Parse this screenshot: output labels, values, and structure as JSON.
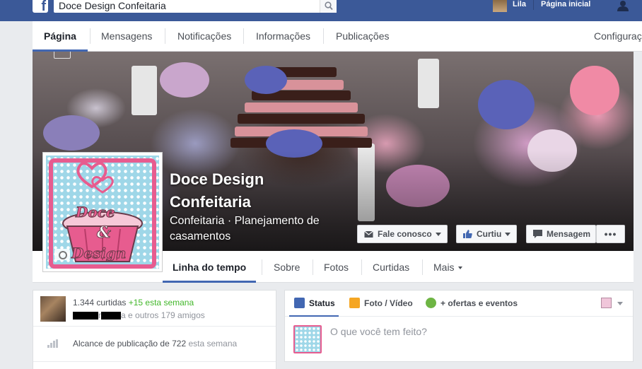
{
  "topbar": {
    "search_value": "Doce Design Confeitaria",
    "user_name": "Lila",
    "home_label": "Página inicial"
  },
  "page_nav": {
    "tabs": [
      {
        "label": "Página",
        "active": true
      },
      {
        "label": "Mensagens",
        "active": false
      },
      {
        "label": "Notificações",
        "active": false
      },
      {
        "label": "Informações",
        "active": false
      },
      {
        "label": "Publicações",
        "active": false
      }
    ],
    "settings_label": "Configuraç"
  },
  "page": {
    "title": "Doce Design Confeitaria",
    "category": "Confeitaria · Planejamento de casamentos",
    "logo_text_1": "Doce",
    "logo_text_2": "&",
    "logo_text_3": "Design"
  },
  "cover_actions": {
    "contact_label": "Fale conosco",
    "liked_label": "Curtiu",
    "message_label": "Mensagem",
    "more_label": "•••"
  },
  "timeline_nav": {
    "items": [
      {
        "label": "Linha do tempo",
        "active": true
      },
      {
        "label": "Sobre",
        "active": false
      },
      {
        "label": "Fotos",
        "active": false
      },
      {
        "label": "Curtidas",
        "active": false
      },
      {
        "label": "Mais",
        "active": false
      }
    ]
  },
  "likes": {
    "count_text": "1.344 curtidas",
    "week_delta": "+15 esta semana",
    "friends_mid": "r",
    "friends_suffix": "a e outros 179 amigos"
  },
  "reach": {
    "text": "Alcance de publicação de 722",
    "suffix": "esta semana"
  },
  "composer": {
    "tabs": [
      {
        "label": "Status",
        "icon": "pencil-icon",
        "color": "#4267b2"
      },
      {
        "label": "Foto / Vídeo",
        "icon": "photo-icon",
        "color": "#f5a623"
      },
      {
        "label": "+ ofertas e eventos",
        "icon": "offers-icon",
        "color": "#6eb544"
      }
    ],
    "placeholder": "O que você tem feito?"
  },
  "colors": {
    "brand_blue": "#3b5998",
    "accent": "#4267b2",
    "logo_pink": "#e75c8f",
    "logo_blue": "#9fd7e8",
    "positive_green": "#42b72a"
  }
}
